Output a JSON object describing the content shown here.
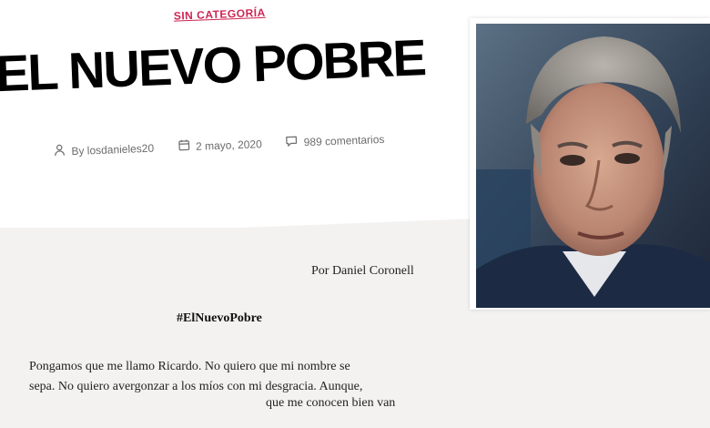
{
  "article": {
    "category": "SIN CATEGORÍA",
    "title": "EL NUEVO POBRE",
    "meta": {
      "author": "By losdanieles20",
      "date": "2 mayo, 2020",
      "comments": "989 comentarios"
    }
  },
  "document": {
    "byline": "Por Daniel Coronell",
    "hashtag": "#ElNuevoPobre",
    "paragraph_lines": [
      "Pongamos que me llamo Ricardo. No quiero que mi nombre se",
      "sepa. No quiero avergonzar a los míos con mi desgracia. Aunque,",
      "que me conocen bien van"
    ]
  },
  "icons": [
    "user-icon",
    "calendar-icon",
    "comment-icon"
  ],
  "colors": {
    "accent": "#cd2653",
    "meta_text": "#6d6d6d"
  }
}
